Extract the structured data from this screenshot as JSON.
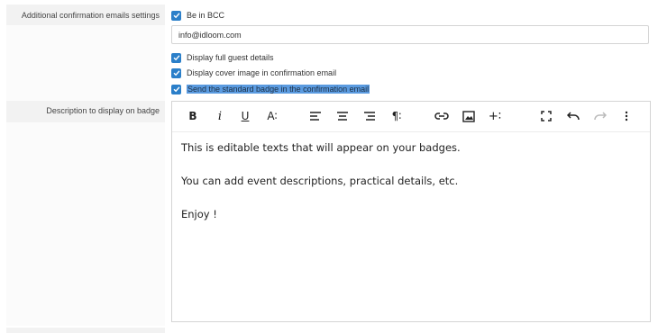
{
  "settings": {
    "confirmation_label": "Additional confirmation emails settings",
    "badge_desc_label": "Description to display on badge"
  },
  "bcc": {
    "label": "Be in BCC",
    "checked": true
  },
  "email_field": {
    "value": "info@idloom.com"
  },
  "options": [
    {
      "label": "Display full guest details",
      "checked": true
    },
    {
      "label": "Display cover image in confirmation email",
      "checked": true
    },
    {
      "label": "Send the standard badge in the confirmation email",
      "checked": true,
      "selected": true
    }
  ],
  "editor": {
    "toolbar": {
      "bold": "B",
      "italic": "i",
      "underline": "U",
      "font_size": "A∶",
      "paragraph": "¶∶",
      "insert": "+∶"
    },
    "paragraphs": [
      "This is editable texts that will appear on your badges.",
      "You can add event descriptions, practical details, etc.",
      "Enjoy !"
    ]
  },
  "colors": {
    "accent": "#2b7fc9",
    "selection": "#5b9be0"
  }
}
